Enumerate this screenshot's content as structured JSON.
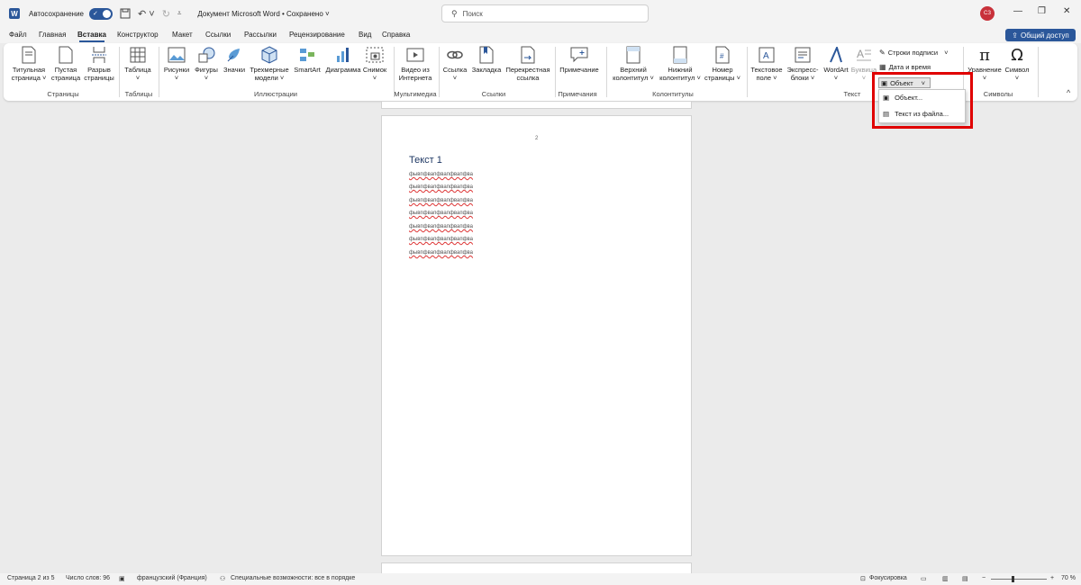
{
  "titlebar": {
    "autosave_label": "Автосохранение",
    "doc_title": "Документ Microsoft Word • Сохранено",
    "search_placeholder": "Поиск",
    "user_initials": "СЗ",
    "logo": "W"
  },
  "menu": {
    "tabs": [
      "Файл",
      "Главная",
      "Вставка",
      "Конструктор",
      "Макет",
      "Ссылки",
      "Рассылки",
      "Рецензирование",
      "Вид",
      "Справка"
    ],
    "active_tab": "Вставка",
    "share_label": "Общий доступ"
  },
  "ribbon": {
    "buttons": [
      {
        "label": "Титульная\nстраница ˅",
        "icon": "title-page-icon"
      },
      {
        "label": "Пустая\nстраница",
        "icon": "blank-page-icon"
      },
      {
        "label": "Разрыв\nстраницы",
        "icon": "page-break-icon"
      },
      {
        "label": "Таблица\n˅",
        "icon": "table-icon"
      },
      {
        "label": "Рисунки\n˅",
        "icon": "pictures-icon"
      },
      {
        "label": "Фигуры\n˅",
        "icon": "shapes-icon"
      },
      {
        "label": "Значки",
        "icon": "icons-icon"
      },
      {
        "label": "Трехмерные\nмодели ˅",
        "icon": "3d-models-icon"
      },
      {
        "label": "SmartArt",
        "icon": "smartart-icon"
      },
      {
        "label": "Диаграмма",
        "icon": "chart-icon"
      },
      {
        "label": "Снимок\n˅",
        "icon": "screenshot-icon"
      },
      {
        "label": "Видео из\nИнтернета",
        "icon": "online-video-icon"
      },
      {
        "label": "Ссылка\n˅",
        "icon": "link-icon"
      },
      {
        "label": "Закладка",
        "icon": "bookmark-icon"
      },
      {
        "label": "Перекрестная\nссылка",
        "icon": "cross-reference-icon"
      },
      {
        "label": "Примечание",
        "icon": "comment-icon"
      },
      {
        "label": "Верхний\nколонтитул ˅",
        "icon": "header-icon"
      },
      {
        "label": "Нижний\nколонтитул ˅",
        "icon": "footer-icon"
      },
      {
        "label": "Номер\nстраницы ˅",
        "icon": "page-number-icon"
      },
      {
        "label": "Текстовое\nполе ˅",
        "icon": "text-box-icon"
      },
      {
        "label": "Экспресс-\nблоки ˅",
        "icon": "quick-parts-icon"
      },
      {
        "label": "WordArt\n˅",
        "icon": "wordart-icon"
      },
      {
        "label": "Буквица\n˅",
        "icon": "drop-cap-icon"
      },
      {
        "label": "Уравнение\n˅",
        "icon": "equation-icon"
      },
      {
        "label": "Символ\n˅",
        "icon": "symbol-icon"
      }
    ],
    "groups": [
      "Страницы",
      "Таблицы",
      "Иллюстрации",
      "Мультимедиа",
      "Ссылки",
      "Примечания",
      "Колонтитулы",
      "Текст",
      "Символы"
    ],
    "text_small_items": {
      "signature_line": "Строки подписи",
      "date_time": "Дата и время",
      "object": "Объект"
    }
  },
  "dropdown": {
    "items": [
      "Объект...",
      "Текст из файла..."
    ]
  },
  "document": {
    "page_number": "2",
    "heading": "Текст 1",
    "lines": [
      "фывпфвапфвапфвапфва",
      "фывпфвапфвапфвапфва",
      "фывпфвапфвапфвапфва",
      "фывпфвапфвапфвапфва",
      "фывпфвапфвапфвапфва",
      "фывпфвапфвапфвапфва",
      "фывпфвапфвапфвапфва"
    ]
  },
  "statusbar": {
    "page": "Страница 2 из 5",
    "words": "Число слов: 96",
    "language": "французский (Франция)",
    "accessibility": "Специальные возможности: все в порядке",
    "focus": "Фокусировка",
    "zoom": "70 %"
  },
  "colors": {
    "accent": "#2b579a",
    "highlight": "#e00000",
    "avatar": "#c8313a"
  }
}
